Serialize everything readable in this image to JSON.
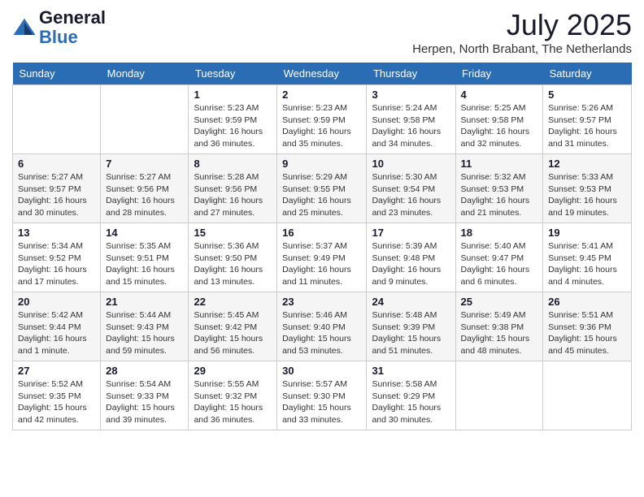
{
  "header": {
    "logo_general": "General",
    "logo_blue": "Blue",
    "month_year": "July 2025",
    "location": "Herpen, North Brabant, The Netherlands"
  },
  "days_of_week": [
    "Sunday",
    "Monday",
    "Tuesday",
    "Wednesday",
    "Thursday",
    "Friday",
    "Saturday"
  ],
  "weeks": [
    [
      {
        "day": "",
        "info": ""
      },
      {
        "day": "",
        "info": ""
      },
      {
        "day": "1",
        "info": "Sunrise: 5:23 AM\nSunset: 9:59 PM\nDaylight: 16 hours\nand 36 minutes."
      },
      {
        "day": "2",
        "info": "Sunrise: 5:23 AM\nSunset: 9:59 PM\nDaylight: 16 hours\nand 35 minutes."
      },
      {
        "day": "3",
        "info": "Sunrise: 5:24 AM\nSunset: 9:58 PM\nDaylight: 16 hours\nand 34 minutes."
      },
      {
        "day": "4",
        "info": "Sunrise: 5:25 AM\nSunset: 9:58 PM\nDaylight: 16 hours\nand 32 minutes."
      },
      {
        "day": "5",
        "info": "Sunrise: 5:26 AM\nSunset: 9:57 PM\nDaylight: 16 hours\nand 31 minutes."
      }
    ],
    [
      {
        "day": "6",
        "info": "Sunrise: 5:27 AM\nSunset: 9:57 PM\nDaylight: 16 hours\nand 30 minutes."
      },
      {
        "day": "7",
        "info": "Sunrise: 5:27 AM\nSunset: 9:56 PM\nDaylight: 16 hours\nand 28 minutes."
      },
      {
        "day": "8",
        "info": "Sunrise: 5:28 AM\nSunset: 9:56 PM\nDaylight: 16 hours\nand 27 minutes."
      },
      {
        "day": "9",
        "info": "Sunrise: 5:29 AM\nSunset: 9:55 PM\nDaylight: 16 hours\nand 25 minutes."
      },
      {
        "day": "10",
        "info": "Sunrise: 5:30 AM\nSunset: 9:54 PM\nDaylight: 16 hours\nand 23 minutes."
      },
      {
        "day": "11",
        "info": "Sunrise: 5:32 AM\nSunset: 9:53 PM\nDaylight: 16 hours\nand 21 minutes."
      },
      {
        "day": "12",
        "info": "Sunrise: 5:33 AM\nSunset: 9:53 PM\nDaylight: 16 hours\nand 19 minutes."
      }
    ],
    [
      {
        "day": "13",
        "info": "Sunrise: 5:34 AM\nSunset: 9:52 PM\nDaylight: 16 hours\nand 17 minutes."
      },
      {
        "day": "14",
        "info": "Sunrise: 5:35 AM\nSunset: 9:51 PM\nDaylight: 16 hours\nand 15 minutes."
      },
      {
        "day": "15",
        "info": "Sunrise: 5:36 AM\nSunset: 9:50 PM\nDaylight: 16 hours\nand 13 minutes."
      },
      {
        "day": "16",
        "info": "Sunrise: 5:37 AM\nSunset: 9:49 PM\nDaylight: 16 hours\nand 11 minutes."
      },
      {
        "day": "17",
        "info": "Sunrise: 5:39 AM\nSunset: 9:48 PM\nDaylight: 16 hours\nand 9 minutes."
      },
      {
        "day": "18",
        "info": "Sunrise: 5:40 AM\nSunset: 9:47 PM\nDaylight: 16 hours\nand 6 minutes."
      },
      {
        "day": "19",
        "info": "Sunrise: 5:41 AM\nSunset: 9:45 PM\nDaylight: 16 hours\nand 4 minutes."
      }
    ],
    [
      {
        "day": "20",
        "info": "Sunrise: 5:42 AM\nSunset: 9:44 PM\nDaylight: 16 hours\nand 1 minute."
      },
      {
        "day": "21",
        "info": "Sunrise: 5:44 AM\nSunset: 9:43 PM\nDaylight: 15 hours\nand 59 minutes."
      },
      {
        "day": "22",
        "info": "Sunrise: 5:45 AM\nSunset: 9:42 PM\nDaylight: 15 hours\nand 56 minutes."
      },
      {
        "day": "23",
        "info": "Sunrise: 5:46 AM\nSunset: 9:40 PM\nDaylight: 15 hours\nand 53 minutes."
      },
      {
        "day": "24",
        "info": "Sunrise: 5:48 AM\nSunset: 9:39 PM\nDaylight: 15 hours\nand 51 minutes."
      },
      {
        "day": "25",
        "info": "Sunrise: 5:49 AM\nSunset: 9:38 PM\nDaylight: 15 hours\nand 48 minutes."
      },
      {
        "day": "26",
        "info": "Sunrise: 5:51 AM\nSunset: 9:36 PM\nDaylight: 15 hours\nand 45 minutes."
      }
    ],
    [
      {
        "day": "27",
        "info": "Sunrise: 5:52 AM\nSunset: 9:35 PM\nDaylight: 15 hours\nand 42 minutes."
      },
      {
        "day": "28",
        "info": "Sunrise: 5:54 AM\nSunset: 9:33 PM\nDaylight: 15 hours\nand 39 minutes."
      },
      {
        "day": "29",
        "info": "Sunrise: 5:55 AM\nSunset: 9:32 PM\nDaylight: 15 hours\nand 36 minutes."
      },
      {
        "day": "30",
        "info": "Sunrise: 5:57 AM\nSunset: 9:30 PM\nDaylight: 15 hours\nand 33 minutes."
      },
      {
        "day": "31",
        "info": "Sunrise: 5:58 AM\nSunset: 9:29 PM\nDaylight: 15 hours\nand 30 minutes."
      },
      {
        "day": "",
        "info": ""
      },
      {
        "day": "",
        "info": ""
      }
    ]
  ]
}
